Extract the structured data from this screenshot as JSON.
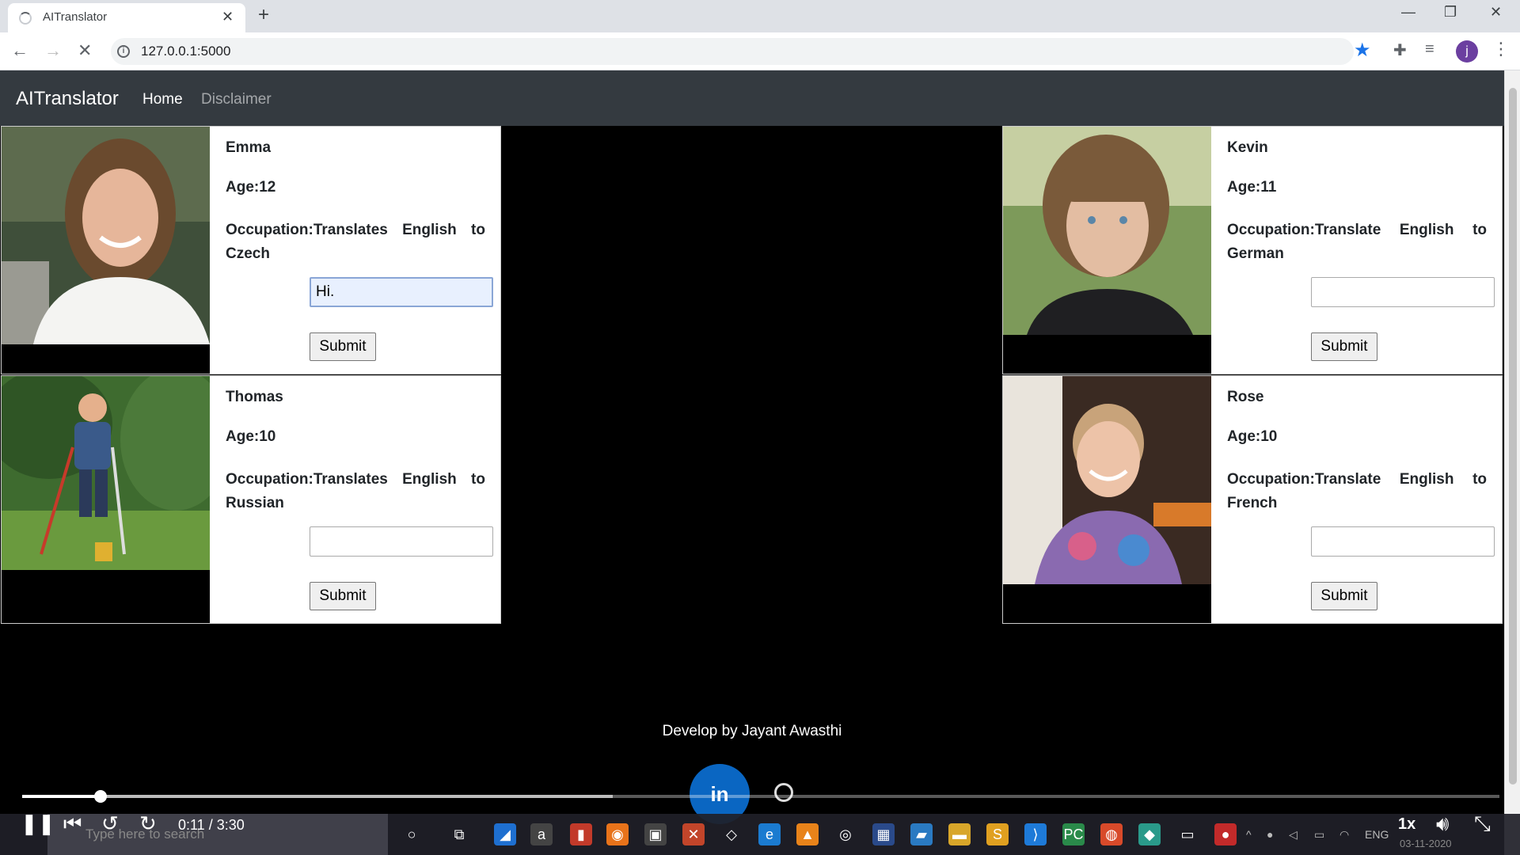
{
  "browser": {
    "tab_title": "AITranslator",
    "url": "127.0.0.1:5000",
    "new_tab": "+",
    "profile_initial": "j"
  },
  "nav": {
    "brand": "AITranslator",
    "home": "Home",
    "disclaimer": "Disclaimer"
  },
  "cards": [
    {
      "name": "Emma",
      "age": "Age:12",
      "occupation": "Occupation:Translates English to Czech",
      "input_value": "Hi.",
      "submit": "Submit"
    },
    {
      "name": "Thomas",
      "age": "Age:10",
      "occupation": "Occupation:Translates English to Russian",
      "input_value": "",
      "submit": "Submit"
    },
    {
      "name": "Kevin",
      "age": "Age:11",
      "occupation": "Occupation:Translate English to German",
      "input_value": "",
      "submit": "Submit"
    },
    {
      "name": "Rose",
      "age": "Age:10",
      "occupation": "Occupation:Translate English to French",
      "input_value": "",
      "submit": "Submit"
    }
  ],
  "footer": {
    "credit": "Develop by Jayant Awasthi",
    "linkedin": "in"
  },
  "video": {
    "time": "0:11 / 3:30",
    "speed": "1x",
    "progress": 0.053,
    "buffered": 0.4
  },
  "taskbar": {
    "search_placeholder": "Type here to search",
    "language": "ENG",
    "date": "03-11-2020"
  }
}
